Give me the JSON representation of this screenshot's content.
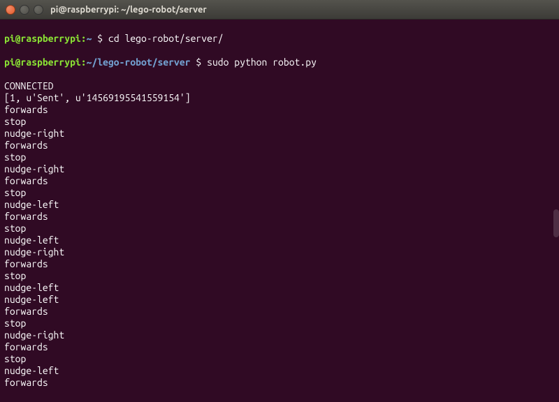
{
  "window": {
    "title": "pi@raspberrypi: ~/lego-robot/server"
  },
  "prompts": [
    {
      "user": "pi@raspberrypi",
      "sep": ":",
      "path": "~",
      "dollar": " $ ",
      "command": "cd lego-robot/server/"
    },
    {
      "user": "pi@raspberrypi",
      "sep": ":",
      "path": "~/lego-robot/server",
      "dollar": " $ ",
      "command": "sudo python robot.py"
    }
  ],
  "output_lines": [
    "CONNECTED",
    "[1, u'Sent', u'14569195541559154']",
    "forwards",
    "stop",
    "nudge-right",
    "forwards",
    "stop",
    "nudge-right",
    "forwards",
    "stop",
    "nudge-left",
    "forwards",
    "stop",
    "nudge-left",
    "nudge-right",
    "forwards",
    "stop",
    "nudge-left",
    "nudge-left",
    "forwards",
    "stop",
    "nudge-right",
    "forwards",
    "stop",
    "nudge-left",
    "forwards"
  ]
}
